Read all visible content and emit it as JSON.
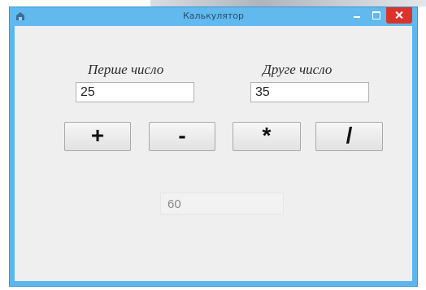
{
  "window": {
    "title": "Калькулятор",
    "accent_color": "#5db6ec",
    "close_color": "#d9342b",
    "controls": [
      "minimize-icon",
      "maximize-icon",
      "close-icon"
    ]
  },
  "labels": {
    "first": "Перше число",
    "second": "Друге число"
  },
  "inputs": {
    "first_value": "25",
    "second_value": "35"
  },
  "operations": [
    "+",
    "-",
    "*",
    "/"
  ],
  "result": "60"
}
